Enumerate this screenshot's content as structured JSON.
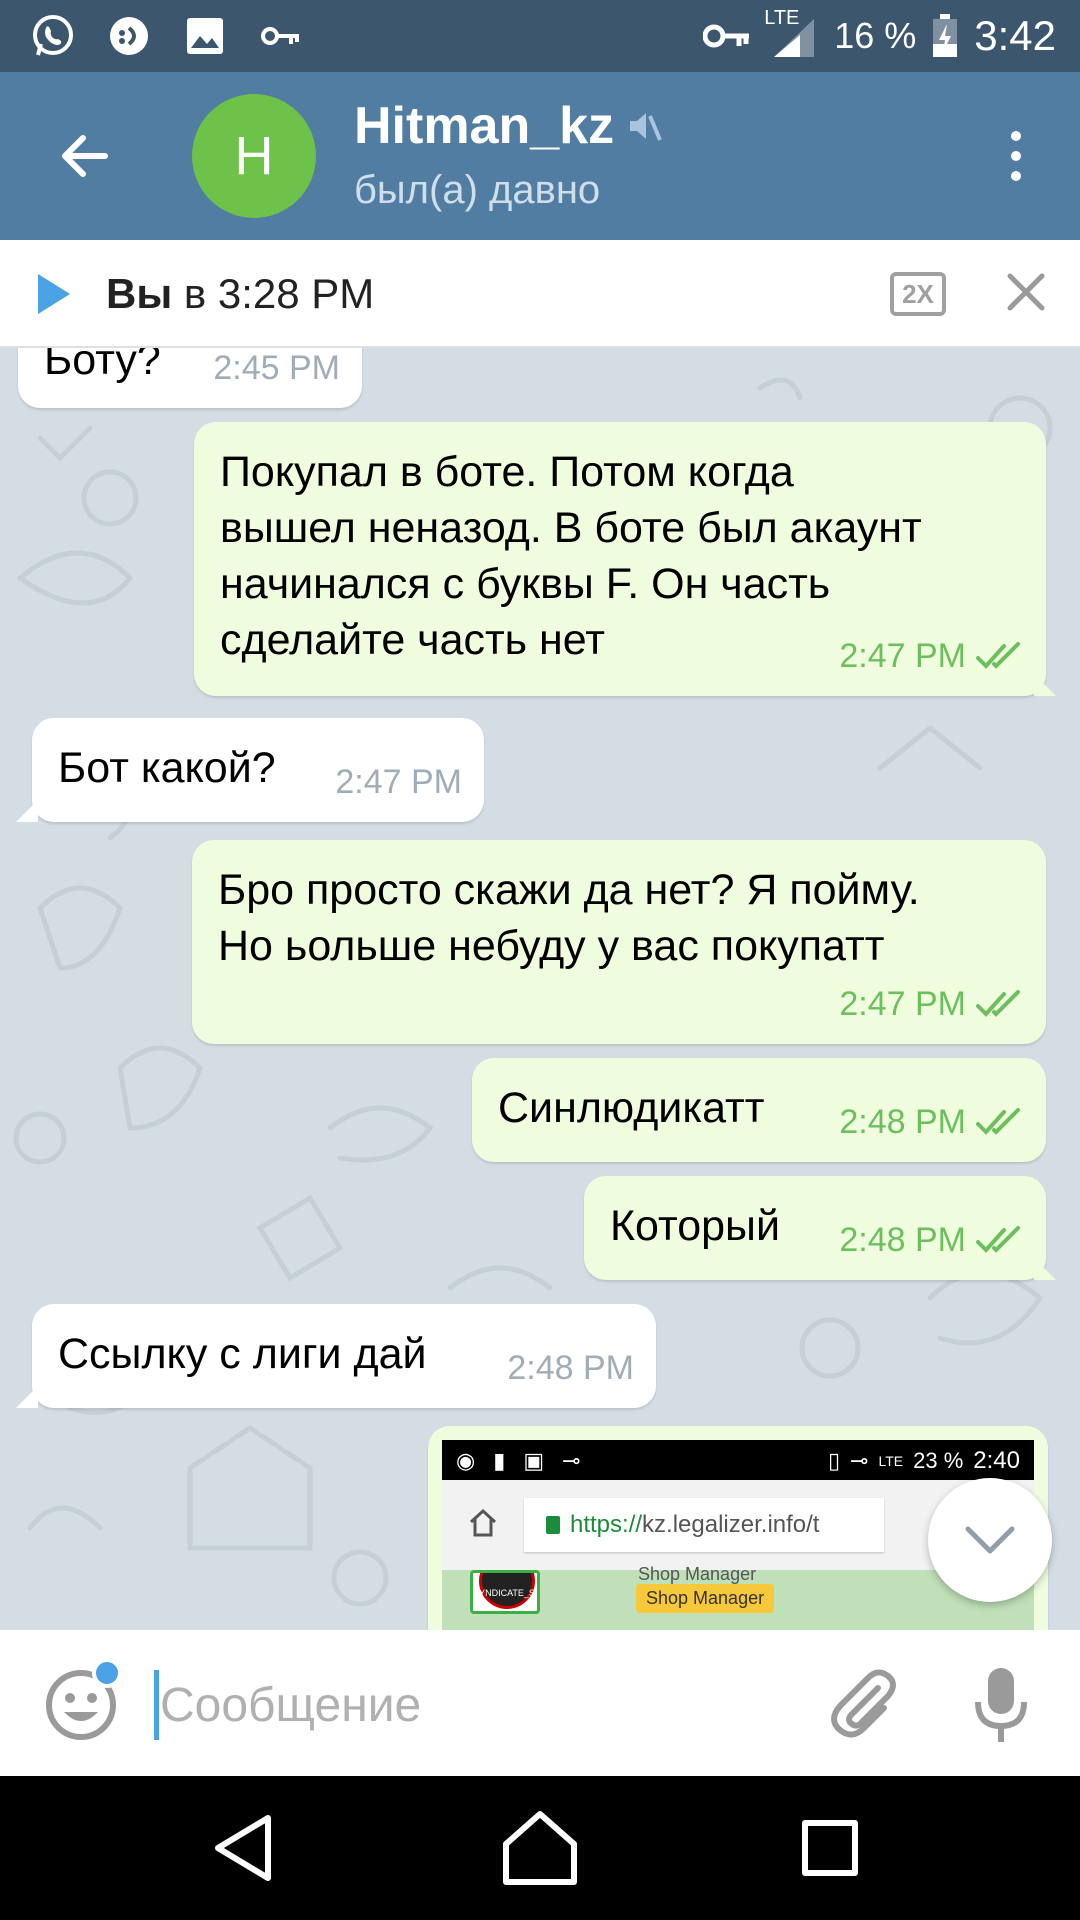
{
  "status_bar": {
    "network": "LTE",
    "battery_percent": "16 %",
    "time": "3:42",
    "left_icons": [
      "whatsapp-icon",
      "notification-icon",
      "image-icon",
      "vpn-key-icon"
    ]
  },
  "header": {
    "avatar_letter": "H",
    "avatar_color": "#6dc24a",
    "title": "Hitman_kz",
    "status": "был(а) давно",
    "bar_color": "#517da2"
  },
  "player": {
    "sender": "Вы",
    "time_text": " в 3:28 PM",
    "speed_label": "2X"
  },
  "messages": [
    {
      "id": "m0",
      "dir": "in",
      "text": "Боту?",
      "time": "2:45 PM"
    },
    {
      "id": "m1",
      "dir": "out",
      "text": "Покупал в боте. Потом когда\nвышел неназод. В боте был акаунт\nначинался с буквы F. Он часть\nсделайте часть нет",
      "time": "2:47 PM"
    },
    {
      "id": "m2",
      "dir": "in",
      "text": "Бот какой?",
      "time": "2:47 PM"
    },
    {
      "id": "m3",
      "dir": "out",
      "text": "Бро просто скажи да нет? Я пойму.\nНо ьольше небуду у вас покупатт",
      "time": "2:47 PM"
    },
    {
      "id": "m4",
      "dir": "out",
      "text": "Синлюдикатт",
      "time": "2:48 PM"
    },
    {
      "id": "m5",
      "dir": "out",
      "text": "Который",
      "time": "2:48 PM"
    },
    {
      "id": "m6",
      "dir": "in",
      "text": "Ссылку с лиги дай",
      "time": "2:48 PM"
    }
  ],
  "screenshot_message": {
    "status_battery": "23 %",
    "status_time": "2:40",
    "status_network": "LTE",
    "url_scheme": "https://",
    "url_rest": "kz.legalizer.info/t",
    "logo_text": "YNDICATE_S",
    "label": "Shop Manager",
    "badge": "Shop Manager"
  },
  "input": {
    "placeholder": "Сообщение",
    "value": ""
  },
  "colors": {
    "incoming_bubble": "#ffffff",
    "outgoing_bubble": "#effdde",
    "outgoing_time": "#6dbf5e",
    "incoming_time": "#a0acb6",
    "accent": "#4aa3e4",
    "chat_background": "#d3dde3"
  }
}
